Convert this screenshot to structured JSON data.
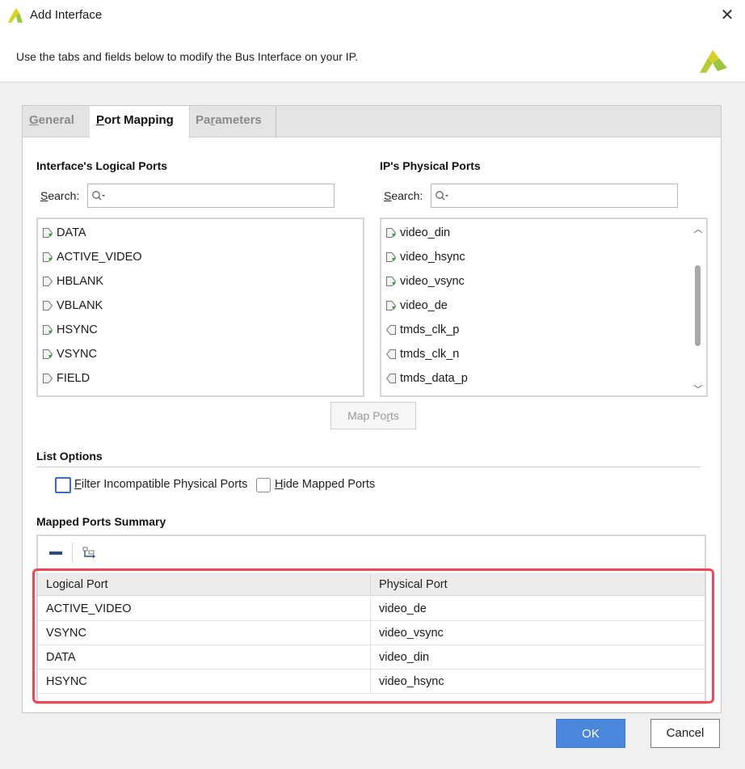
{
  "window": {
    "title": "Add Interface",
    "close_glyph": "✕",
    "description": "Use the tabs and fields below to modify the Bus Interface on your IP."
  },
  "tabs": [
    {
      "label_u": "G",
      "label_rest": "eneral"
    },
    {
      "label_u": "P",
      "label_rest": "ort Mapping"
    },
    {
      "label_pre": "Pa",
      "label_u": "r",
      "label_rest": "ameters"
    }
  ],
  "logical": {
    "title": "Interface's Logical Ports",
    "search_label_u": "S",
    "search_label_rest": "earch:",
    "items": [
      {
        "name": "DATA",
        "mapped": true
      },
      {
        "name": "ACTIVE_VIDEO",
        "mapped": true
      },
      {
        "name": "HBLANK",
        "mapped": false
      },
      {
        "name": "VBLANK",
        "mapped": false
      },
      {
        "name": "HSYNC",
        "mapped": true
      },
      {
        "name": "VSYNC",
        "mapped": true
      },
      {
        "name": "FIELD",
        "mapped": false
      }
    ]
  },
  "physical": {
    "title": "IP's Physical Ports",
    "search_label_u": "S",
    "search_label_rest": "earch:",
    "items": [
      {
        "name": "video_din",
        "dir": "in"
      },
      {
        "name": "video_hsync",
        "dir": "in"
      },
      {
        "name": "video_vsync",
        "dir": "in"
      },
      {
        "name": "video_de",
        "dir": "in"
      },
      {
        "name": "tmds_clk_p",
        "dir": "out"
      },
      {
        "name": "tmds_clk_n",
        "dir": "out"
      },
      {
        "name": "tmds_data_p",
        "dir": "out"
      }
    ],
    "scroll_fraction": 0.45
  },
  "map_button": {
    "label_pre": "Map Po",
    "label_u": "r",
    "label_rest": "ts"
  },
  "list_options": {
    "title": "List Options",
    "filter_u": "F",
    "filter_rest": "ilter Incompatible Physical Ports",
    "hide_u": "H",
    "hide_rest": "ide Mapped Ports",
    "filter_checked": false,
    "hide_checked": false
  },
  "summary": {
    "title": "Mapped Ports Summary",
    "headers": [
      "Logical Port",
      "Physical Port"
    ],
    "rows": [
      {
        "logical": "ACTIVE_VIDEO",
        "physical": "video_de"
      },
      {
        "logical": "VSYNC",
        "physical": "video_vsync"
      },
      {
        "logical": "DATA",
        "physical": "video_din"
      },
      {
        "logical": "HSYNC",
        "physical": "video_hsync"
      }
    ]
  },
  "buttons": {
    "ok": "OK",
    "cancel": "Cancel"
  },
  "colors": {
    "highlight": "#f0485a",
    "ok_button": "#4a86dc",
    "port_mapped_mark": "#3a9b3a",
    "logo": "#9cc63b"
  }
}
